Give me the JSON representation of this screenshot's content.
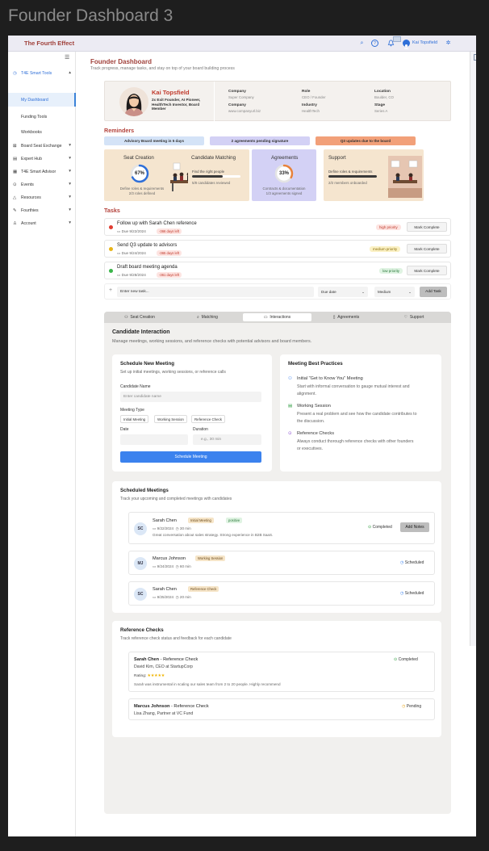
{
  "frame_title": "Founder Dashboard 3",
  "topbar": {
    "brand": "The Fourth Effect",
    "user_name": "Kai Topsfield",
    "icons": [
      "search-icon",
      "help-icon",
      "bell-icon",
      "avatar",
      "settings-icon"
    ]
  },
  "sidebar": {
    "items": [
      {
        "label": "T4E Smart Tools",
        "icon": "tools-icon",
        "chevron": "▴"
      },
      {
        "label": "My Dashboard"
      },
      {
        "label": "Funding Tools"
      },
      {
        "label": "Workbooks"
      },
      {
        "label": "Board Seat Exchange",
        "icon": "exchange-icon",
        "chevron": "▾"
      },
      {
        "label": "Expert Hub",
        "icon": "hub-icon",
        "chevron": "▾"
      },
      {
        "label": "T4E Smart Advisor",
        "icon": "advisor-icon",
        "chevron": "▾"
      },
      {
        "label": "Events",
        "icon": "events-icon",
        "chevron": "▾"
      },
      {
        "label": "Resources",
        "icon": "resources-icon",
        "chevron": "▾"
      },
      {
        "label": "Fourthies",
        "icon": "fourthies-icon",
        "chevron": "▾"
      },
      {
        "label": "Account",
        "icon": "account-icon",
        "chevron": "▾"
      }
    ]
  },
  "header": {
    "title": "Founder Dashboard",
    "subtitle": "Track progress, manage tasks, and stay on top of your board building process"
  },
  "profile": {
    "name": "Kai Topsfield",
    "description": "2x Exit Founder, AI Pioneer, HealthTech Investor, Board Member",
    "fields": [
      {
        "label": "Company",
        "value": "Super Company"
      },
      {
        "label": "Role",
        "value": "CEO / Founder"
      },
      {
        "label": "Location",
        "value": "Boulder, CO"
      },
      {
        "label": "Company",
        "value": "www.companyurl.biz"
      },
      {
        "label": "Industry",
        "value": "HealthTech"
      },
      {
        "label": "Stage",
        "value": "Series A"
      }
    ]
  },
  "reminders": {
    "title": "Reminders",
    "pills": [
      {
        "label": "Advisory Board meeting in 5 days",
        "color": "#d4e3f7"
      },
      {
        "label": "2 agreements pending signature",
        "color": "#d3d1f5"
      },
      {
        "label": "Q3 updates due to the board",
        "color": "#f2a079"
      }
    ],
    "cards": [
      {
        "title": "Seat Creation",
        "percent": "67%",
        "progress": 0.67,
        "subtitle": "Define roles & requirements",
        "subtitle2": "2/3 roles defined",
        "color": "#f5e5cf"
      },
      {
        "title": "Candidate Matching",
        "lead": "Find the right people",
        "subtitle": "5/8 candidates reviewed",
        "progress": 0.625,
        "color": "#f5e5cf"
      },
      {
        "title": "Agreements",
        "percent": "33%",
        "progress": 0.33,
        "subtitle": "Contracts & documentation",
        "subtitle2": "1/3 agreements signed",
        "color": "#d3d1f5"
      },
      {
        "title": "Support",
        "lead": "Define roles & requirements",
        "subtitle": "2/2 members onboarded",
        "progress": 1.0,
        "color": "#f5e5cf"
      }
    ]
  },
  "tasks": {
    "title": "Tasks",
    "items": [
      {
        "title": "Follow up with Sarah Chen reference",
        "due": "Due 9/22/2024",
        "days_left": "-366 days left",
        "priority": "high priority",
        "priority_color": "#c0392b",
        "priority_bg": "#fde4e1",
        "dot": "#e03c31",
        "action": "Mark Complete"
      },
      {
        "title": "Send Q3 update to advisors",
        "due": "Due 9/24/2024",
        "days_left": "-365 days left",
        "priority": "medium priority",
        "priority_color": "#8a6d0b",
        "priority_bg": "#fbf1c4",
        "dot": "#e8b417",
        "action": "Mark Complete"
      },
      {
        "title": "Draft board meeting agenda",
        "due": "Due 9/28/2024",
        "days_left": "-361 days left",
        "priority": "low priority",
        "priority_color": "#2c7a3c",
        "priority_bg": "#dff3e2",
        "dot": "#3bb54a",
        "action": "Mark Complete"
      }
    ],
    "new_task": {
      "placeholder": "Enter new task...",
      "due_placeholder": "Due date",
      "priority_value": "Medium",
      "add_label": "Add Task"
    }
  },
  "tabs": [
    {
      "label": "Seat Creation",
      "icon": "people-icon"
    },
    {
      "label": "Matching",
      "icon": "search-icon"
    },
    {
      "label": "Interactions",
      "icon": "chat-icon",
      "active": true
    },
    {
      "label": "Agreements",
      "icon": "document-icon"
    },
    {
      "label": "Support",
      "icon": "heart-icon"
    }
  ],
  "interaction": {
    "title": "Candidate Interaction",
    "subtitle": "Manage meetings, working sessions, and reference checks with potential advisors and board members."
  },
  "schedule": {
    "title": "Schedule New Meeting",
    "subtitle": "Set up initial meetings, working sessions, or reference calls",
    "candidate_label": "Candidate Name",
    "candidate_placeholder": "Enter candidate name",
    "type_label": "Meeting Type",
    "types": [
      "Initial Meeting",
      "Working Session",
      "Reference Check"
    ],
    "date_label": "Date",
    "duration_label": "Duration",
    "duration_placeholder": "e.g., 30 min",
    "button": "Schedule Meeting"
  },
  "best_practices": {
    "title": "Meeting Best Practices",
    "items": [
      {
        "icon": "people-icon",
        "title": "Initial \"Get to Know You\" Meeting",
        "text": "Start with informal conversation to gauge mutual interest and alignment."
      },
      {
        "icon": "document-icon",
        "title": "Working Session",
        "text": "Present a real problem and see how the candidate contributes to the discussion."
      },
      {
        "icon": "check-circle-icon",
        "title": "Reference Checks",
        "text": "Always conduct thorough reference checks with other founders or executives."
      }
    ]
  },
  "scheduled": {
    "title": "Scheduled Meetings",
    "subtitle": "Track your upcoming and completed meetings with candidates",
    "meetings": [
      {
        "initials": "SC",
        "name": "Sarah Chen",
        "type": "Initial Meeting",
        "sentiment": "positive",
        "date": "9/22/2024",
        "duration": "30 min",
        "note": "Great conversation about sales strategy. Strong experience in B2B SaaS.",
        "status": "Completed",
        "action": "Add Notes"
      },
      {
        "initials": "MJ",
        "name": "Marcus Johnson",
        "type": "Working Session",
        "date": "9/24/2024",
        "duration": "60 min",
        "status": "Scheduled"
      },
      {
        "initials": "SC",
        "name": "Sarah Chen",
        "type": "Reference Check",
        "date": "9/25/2024",
        "duration": "20 min",
        "status": "Scheduled"
      }
    ]
  },
  "references": {
    "title": "Reference Checks",
    "subtitle": "Track reference check status and feedback for each candidate",
    "items": [
      {
        "name": "Sarah Chen",
        "suffix": " - Reference Check",
        "referee": "David Kim, CEO at StartupCorp",
        "rating_label": "Rating:",
        "stars": "★★★★★",
        "rating": 5,
        "quote": "Sarah was instrumental in scaling our sales team from 2 to 20 people. Highly recommend",
        "status": "Completed"
      },
      {
        "name": "Marcus Johnson",
        "suffix": " - Reference Check",
        "referee": "Lisa Zhang, Partner at VC Fund",
        "status": "Pending"
      }
    ]
  }
}
